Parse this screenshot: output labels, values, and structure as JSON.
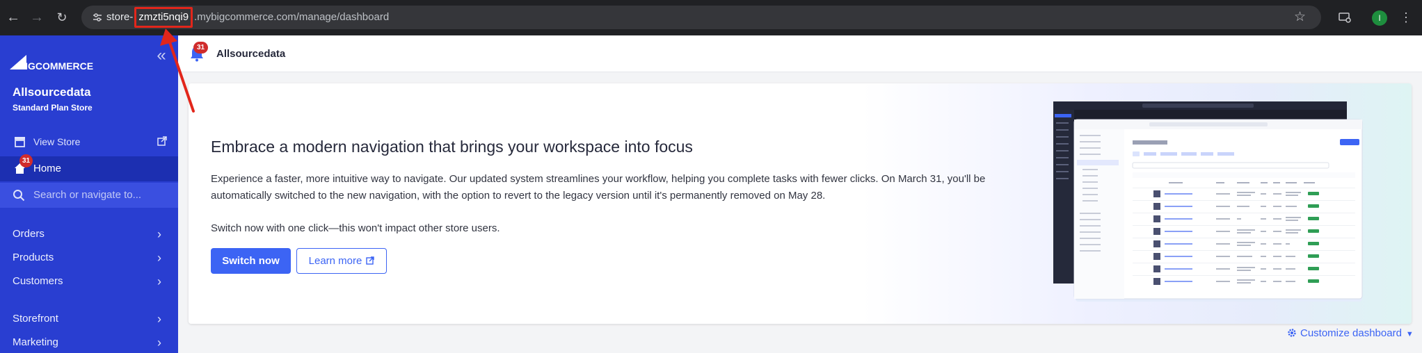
{
  "browser": {
    "url_prefix": "store-",
    "url_highlight": "zmzti5nqi9",
    "url_rest": ".mybigcommerce.com/manage/dashboard",
    "profile_initial": "I"
  },
  "sidebar": {
    "logo_text": "BIGCOMMERCE",
    "store_name": "Allsourcedata",
    "plan": "Standard Plan Store",
    "view_store": "View Store",
    "home": "Home",
    "home_badge": "31",
    "search_placeholder": "Search or navigate to...",
    "items": [
      {
        "label": "Orders"
      },
      {
        "label": "Products"
      },
      {
        "label": "Customers"
      },
      {
        "label": "Storefront"
      },
      {
        "label": "Marketing"
      }
    ]
  },
  "header": {
    "title": "Allsourcedata",
    "notification_count": "31"
  },
  "banner": {
    "title": "Embrace a modern navigation that brings your workspace into focus",
    "body": "Experience a faster, more intuitive way to navigate. Our updated system streamlines your workflow, helping you complete tasks with fewer clicks. On March 31, you'll be automatically switched to the new navigation, with the option to revert to the legacy version until it's permanently removed on May 28.",
    "note": "Switch now with one click—this won't impact other store users.",
    "primary_button": "Switch now",
    "secondary_button": "Learn more"
  },
  "customize": "Customize dashboard",
  "colors": {
    "sidebar": "#293ed1",
    "accent": "#3c64f4",
    "highlight": "#e2261b"
  }
}
